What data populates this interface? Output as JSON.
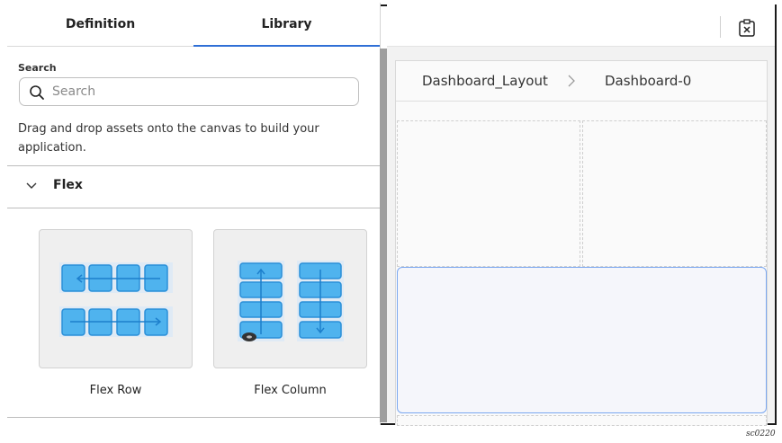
{
  "tabs": {
    "definition": "Definition",
    "library": "Library",
    "active": "library"
  },
  "search": {
    "label": "Search",
    "placeholder": "Search",
    "value": ""
  },
  "help_text": "Drag and drop assets onto the canvas to build your application.",
  "section": {
    "title": "Flex",
    "expanded": true
  },
  "assets": [
    {
      "label": "Flex Row",
      "icon": "flex-row-icon"
    },
    {
      "label": "Flex Column",
      "icon": "flex-column-icon"
    }
  ],
  "breadcrumb": {
    "parent": "Dashboard_Layout",
    "current": "Dashboard-0"
  },
  "icons": {
    "search": "search-icon",
    "chevron": "chevron-down-icon",
    "close": "close-panel-icon",
    "separator": "chevron-right-icon"
  },
  "colors": {
    "accent": "#2f6fd6",
    "asset_blue": "#4fb3ee",
    "selected_border": "#7aa7f0"
  },
  "caption": "sc0220"
}
